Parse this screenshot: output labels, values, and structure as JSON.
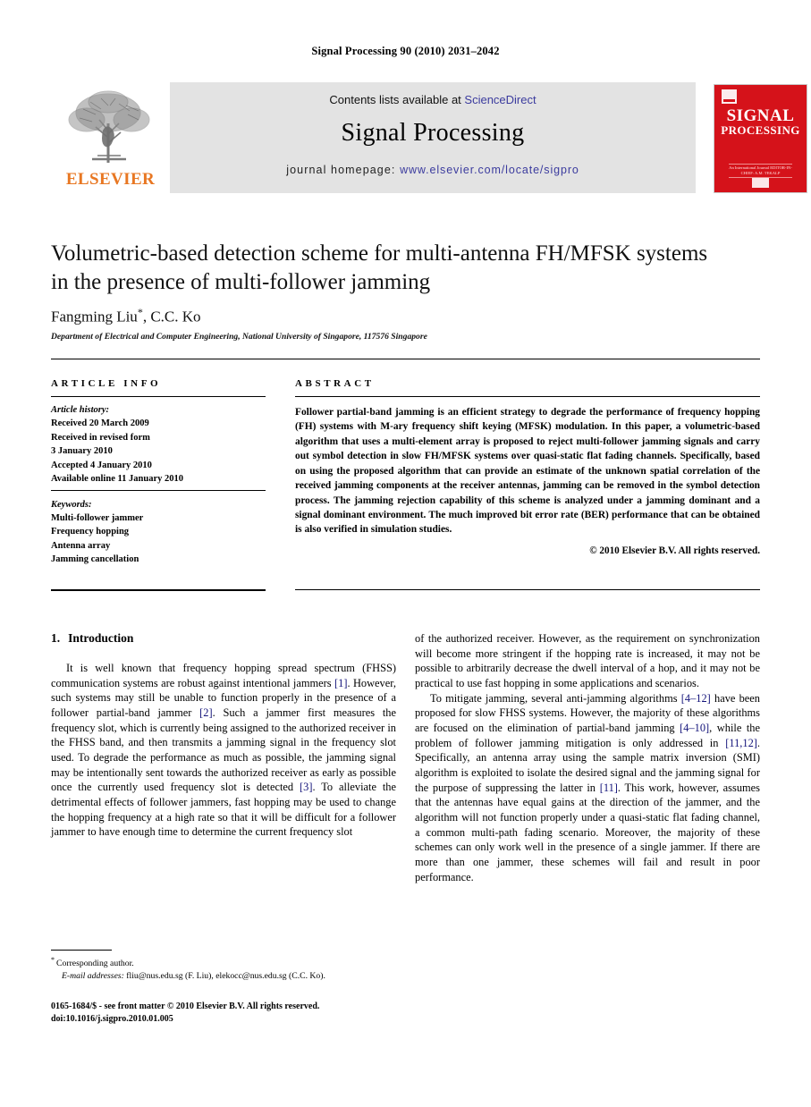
{
  "running_head": "Signal Processing 90 (2010) 2031–2042",
  "banner": {
    "contents_prefix": "Contents lists available at ",
    "sciencedirect": "ScienceDirect",
    "journal_name": "Signal Processing",
    "homepage_prefix": "journal homepage: ",
    "homepage_url": "www.elsevier.com/locate/sigpro",
    "publisher_wordmark": "ELSEVIER",
    "cover": {
      "line1": "SIGNAL",
      "line2": "PROCESSING",
      "subtitle": "An International Journal\nEDITOR-IN-CHIEF: A.M. TEKALP"
    },
    "link_color": "#3b3b9e",
    "elsevier_orange": "#e87722",
    "cover_red": "#d5121a",
    "banner_bg": "#e3e3e3"
  },
  "article": {
    "title": "Volumetric-based detection scheme for multi-antenna FH/MFSK systems in the presence of multi-follower jamming",
    "authors": "Fangming Liu",
    "authors_corresponding_mark": "*",
    "authors_rest": ", C.C. Ko",
    "affiliation": "Department of Electrical and Computer Engineering, National University of Singapore, 117576 Singapore"
  },
  "info": {
    "heading": "ARTICLE INFO",
    "history_label": "Article history:",
    "history": [
      "Received 20 March 2009",
      "Received in revised form",
      "3 January 2010",
      "Accepted 4 January 2010",
      "Available online 11 January 2010"
    ],
    "keywords_label": "Keywords:",
    "keywords": [
      "Multi-follower jammer",
      "Frequency hopping",
      "Antenna array",
      "Jamming cancellation"
    ]
  },
  "abstract": {
    "heading": "ABSTRACT",
    "text": "Follower partial-band jamming is an efficient strategy to degrade the performance of frequency hopping (FH) systems with M-ary frequency shift keying (MFSK) modulation. In this paper, a volumetric-based algorithm that uses a multi-element array is proposed to reject multi-follower jamming signals and carry out symbol detection in slow FH/MFSK systems over quasi-static flat fading channels. Specifically, based on using the proposed algorithm that can provide an estimate of the unknown spatial correlation of the received jamming components at the receiver antennas, jamming can be removed in the symbol detection process. The jamming rejection capability of this scheme is analyzed under a jamming dominant and a signal dominant environment. The much improved bit error rate (BER) performance that can be obtained is also verified in simulation studies.",
    "copyright": "© 2010 Elsevier B.V. All rights reserved."
  },
  "body": {
    "section_number": "1.",
    "section_title": "Introduction",
    "left_paragraph_1": {
      "part1": "It is well known that frequency hopping spread spectrum (FHSS) communication systems are robust against intentional jammers ",
      "cite1": "[1]",
      "part2": ". However, such systems may still be unable to function properly in the presence of a follower partial-band jammer ",
      "cite2": "[2]",
      "part3": ". Such a jammer first measures the frequency slot, which is currently being assigned to the authorized receiver in the FHSS band, and then transmits a jamming signal in the frequency slot used. To degrade the performance as much as possible, the jamming signal may be intentionally sent towards the authorized receiver as early as possible once the currently used frequency slot is detected ",
      "cite3": "[3]",
      "part4": ". To alleviate the detrimental effects of follower jammers, fast hopping may be used to change the hopping frequency at a high rate so that it will be difficult for a follower jammer to have enough time to determine the current frequency slot"
    },
    "right_paragraph_1": "of the authorized receiver. However, as the requirement on synchronization will become more stringent if the hopping rate is increased, it may not be possible to arbitrarily decrease the dwell interval of a hop, and it may not be practical to use fast hopping in some applications and scenarios.",
    "right_paragraph_2": {
      "part1": "To mitigate jamming, several anti-jamming algorithms ",
      "cite1": "[4–12]",
      "part2": " have been proposed for slow FHSS systems. However, the majority of these algorithms are focused on the elimination of partial-band jamming ",
      "cite2": "[4–10]",
      "part3": ", while the problem of follower jamming mitigation is only addressed in ",
      "cite3": "[11,12]",
      "part4": ". Specifically, an antenna array using the sample matrix inversion (SMI) algorithm is exploited to isolate the desired signal and the jamming signal for the purpose of suppressing the latter in ",
      "cite4": "[11]",
      "part5": ". This work, however, assumes that the antennas have equal gains at the direction of the jammer, and the algorithm will not function properly under a quasi-static flat fading channel, a common multi-path fading scenario. Moreover, the majority of these schemes can only work well in the presence of a single jammer. If there are more than one jammer, these schemes will fail and result in poor performance."
    }
  },
  "footnotes": {
    "corresponding_mark": "*",
    "corresponding_text": "Corresponding author.",
    "email_label": "E-mail addresses:",
    "email_text": " fliu@nus.edu.sg (F. Liu), elekocc@nus.edu.sg (C.C. Ko).",
    "issn_line": "0165-1684/$ - see front matter © 2010 Elsevier B.V. All rights reserved.",
    "doi_line": "doi:10.1016/j.sigpro.2010.01.005"
  }
}
